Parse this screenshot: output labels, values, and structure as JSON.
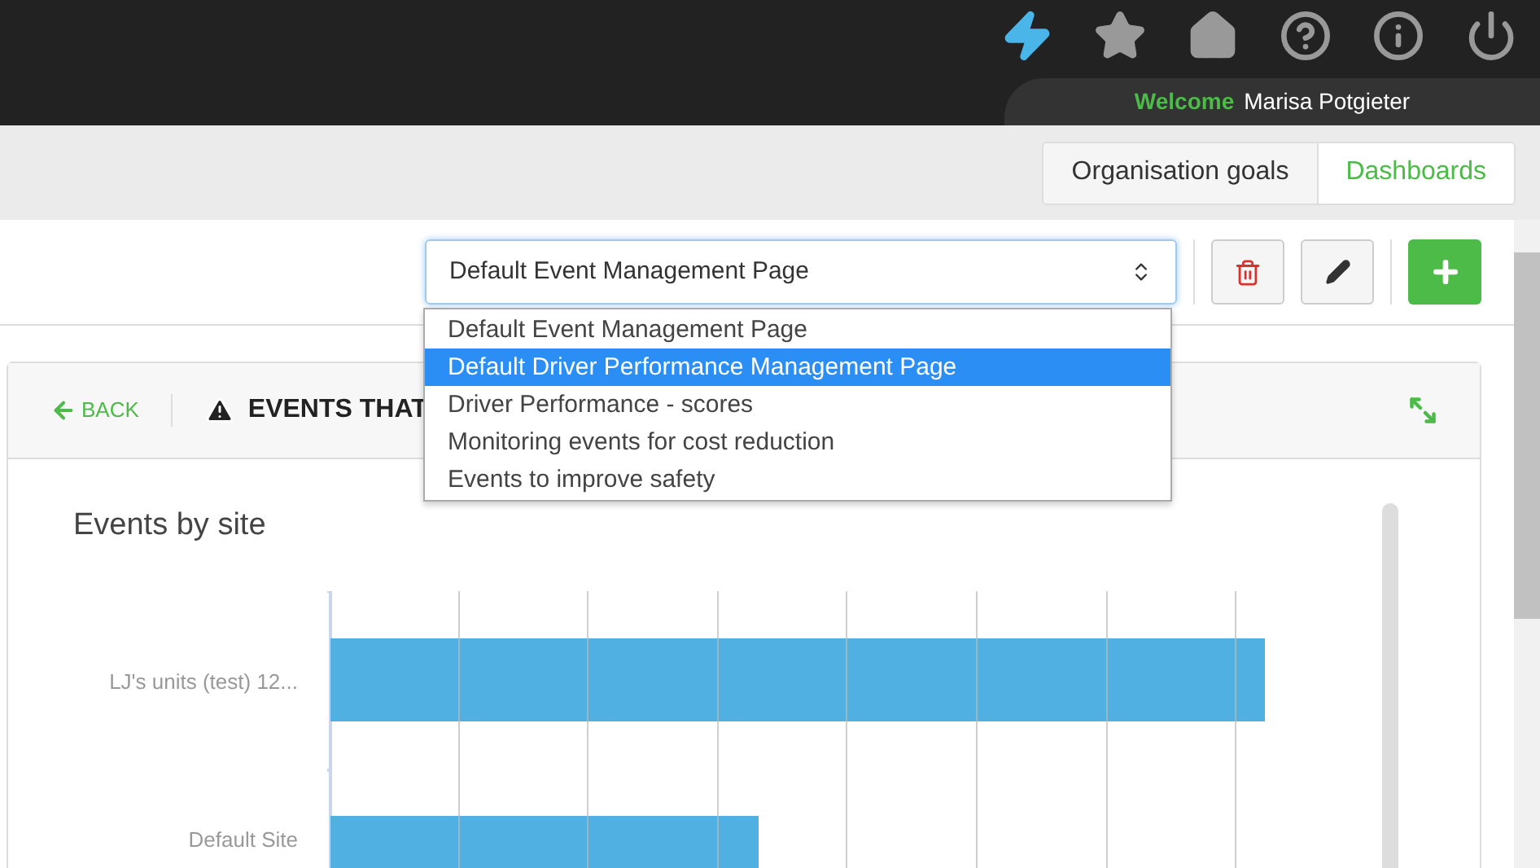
{
  "header": {
    "welcome": "Welcome",
    "user": "Marisa Potgieter"
  },
  "tabs": [
    {
      "label": "Organisation goals",
      "selected": false
    },
    {
      "label": "Dashboards",
      "selected": true
    }
  ],
  "page_select": {
    "value": "Default Event Management Page",
    "expanded": true,
    "options": [
      {
        "label": "Default Event Management Page",
        "highlighted": false
      },
      {
        "label": "Default Driver Performance Management Page",
        "highlighted": true
      },
      {
        "label": "Driver Performance - scores",
        "highlighted": false
      },
      {
        "label": "Monitoring events for cost reduction",
        "highlighted": false
      },
      {
        "label": "Events to improve safety",
        "highlighted": false
      }
    ]
  },
  "card": {
    "back": "BACK",
    "title": "EVENTS THAT",
    "chart_title": "Events by site",
    "chart_labels": [
      "LJ's units (test) 12...",
      "Default Site"
    ]
  }
}
